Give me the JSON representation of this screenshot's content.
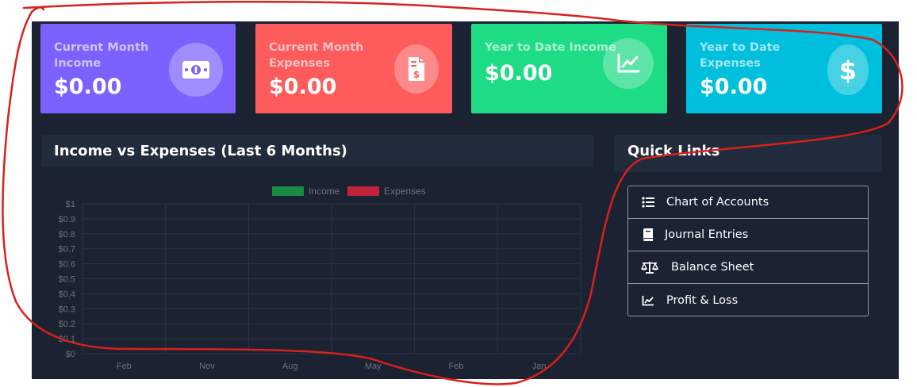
{
  "cards": [
    {
      "title": "Current Month Income",
      "value": "$0.00",
      "color": "#7b61fd",
      "icon": "money-bill-icon"
    },
    {
      "title": "Current Month Expenses",
      "value": "$0.00",
      "color": "#fe5c5c",
      "icon": "invoice-dollar-icon"
    },
    {
      "title": "Year to Date Income",
      "value": "$0.00",
      "color": "#1edc86",
      "icon": "chart-line-icon"
    },
    {
      "title": "Year to Date Expenses",
      "value": "$0.00",
      "color": "#00bfdc",
      "icon": "dollar-sign-icon"
    }
  ],
  "chart_panel": {
    "title": "Income vs Expenses (Last 6 Months)"
  },
  "quick_links": {
    "title": "Quick Links",
    "items": [
      {
        "label": "Chart of Accounts",
        "icon": "list-icon"
      },
      {
        "label": "Journal Entries",
        "icon": "book-icon"
      },
      {
        "label": "Balance Sheet",
        "icon": "scale-icon"
      },
      {
        "label": "Profit & Loss",
        "icon": "chart-line-icon"
      }
    ]
  },
  "chart_data": {
    "type": "bar",
    "categories": [
      "Feb",
      "Nov",
      "Aug",
      "May",
      "Feb",
      "Jan"
    ],
    "series": [
      {
        "name": "Income",
        "values": [
          0,
          0,
          0,
          0,
          0,
          0
        ],
        "color": "#1a8a45"
      },
      {
        "name": "Expenses",
        "values": [
          0,
          0,
          0,
          0,
          0,
          0
        ],
        "color": "#c0243a"
      }
    ],
    "yticks": [
      "$0",
      "$0.1",
      "$0.2",
      "$0.3",
      "$0.4",
      "$0.5",
      "$0.6",
      "$0.7",
      "$0.8",
      "$0.9",
      "$1"
    ],
    "ylim": [
      0,
      1
    ],
    "legend": "top-center",
    "grid": true
  },
  "annotation": {
    "color": "#d9201c"
  }
}
